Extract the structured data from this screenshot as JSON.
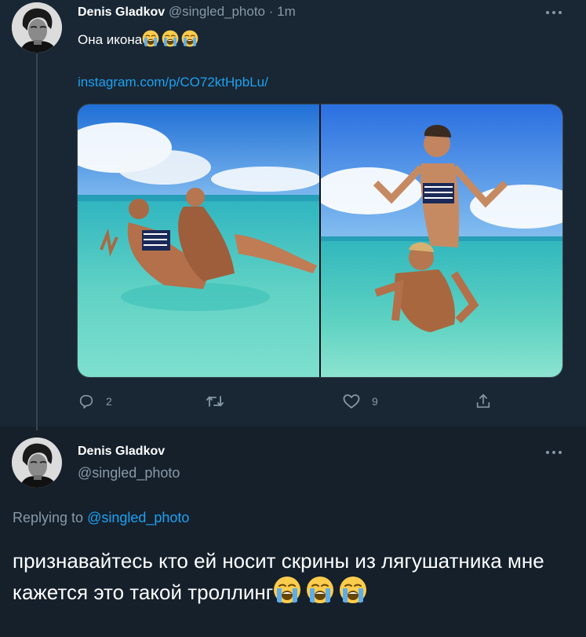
{
  "tweet": {
    "author_name": "Denis Gladkov",
    "author_handle": "@singled_photo",
    "separator": "·",
    "time": "1m",
    "text": "Она икона",
    "emoji_icon": "loudly-crying-face-icon",
    "emoji_count": 3,
    "link": "instagram.com/p/CO72ktHpbLu/",
    "stats": {
      "replies": "2",
      "retweets": "",
      "likes": "9"
    }
  },
  "reply": {
    "author_name": "Denis Gladkov",
    "author_handle": "@singled_photo",
    "replying_label": "Replying to",
    "replying_to": "@singled_photo",
    "text": "признавайтесь кто ей носит скрины из лягушатника мне кажется это такой троллинг",
    "emoji_icon": "loudly-crying-face-icon",
    "emoji_count": 3
  },
  "colors": {
    "background": "#15202b",
    "focused_tweet_background": "#192734",
    "link": "#1da1f2",
    "secondary_text": "#8899a6",
    "divider": "#38444d"
  }
}
